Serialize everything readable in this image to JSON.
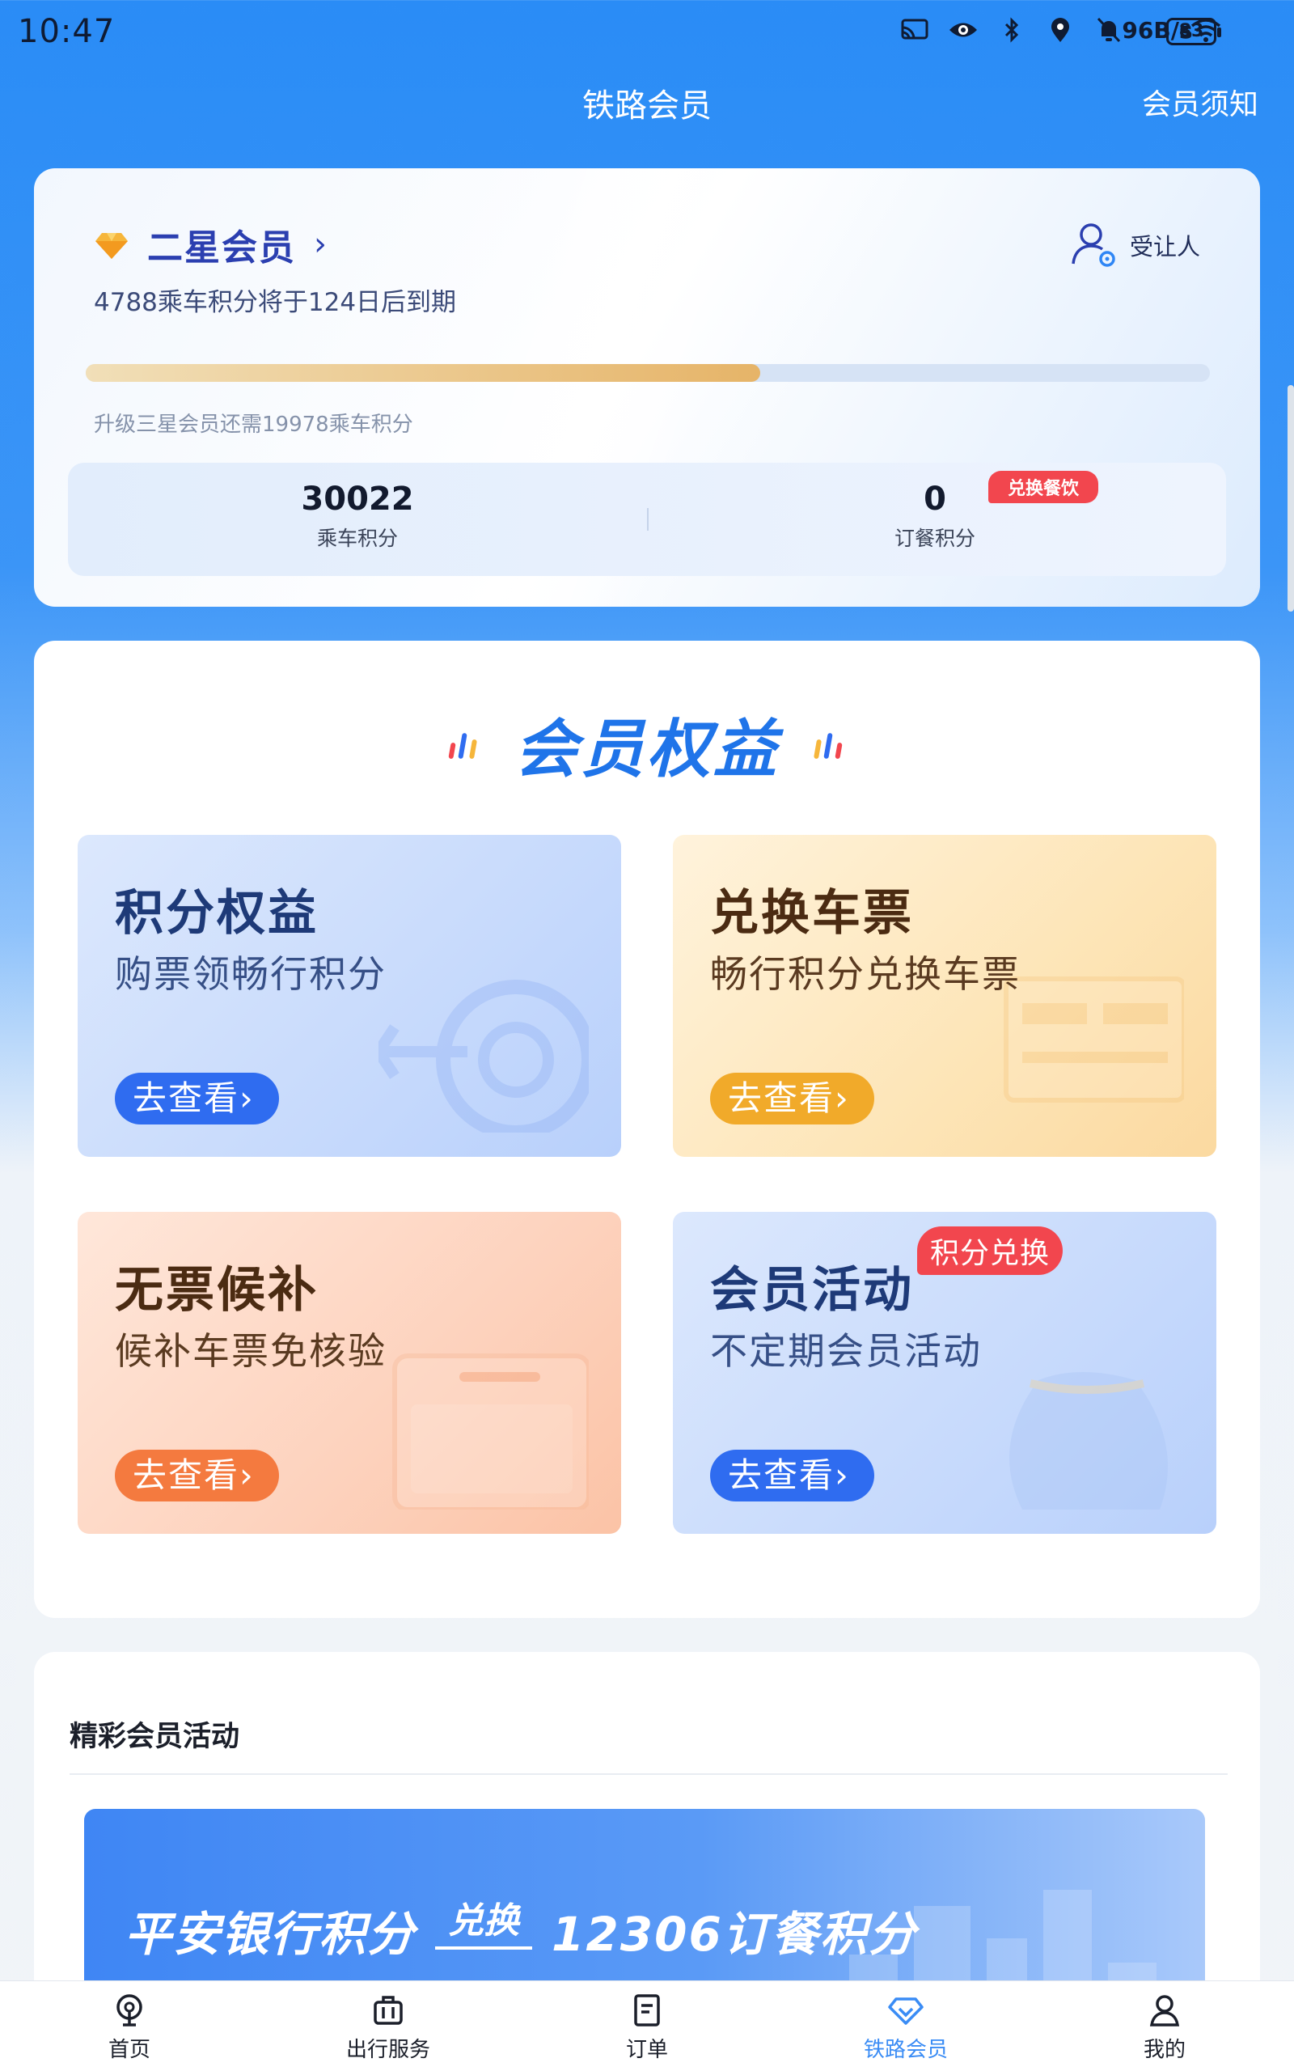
{
  "status_bar": {
    "time": "10:47",
    "net_speed_top": "96",
    "net_speed_bottom": "B/s",
    "battery": "83"
  },
  "header": {
    "title": "铁路会员",
    "notice": "会员须知"
  },
  "member": {
    "level": "二星会员",
    "expire_text": "4788乘车积分将于124日后到期",
    "beneficiary": "受让人",
    "progress": 0.6,
    "upgrade_text": "升级三星会员还需19978乘车积分",
    "ride_points": {
      "value": "30022",
      "label": "乘车积分"
    },
    "meal_points": {
      "value": "0",
      "label": "订餐积分",
      "badge": "兑换餐饮"
    }
  },
  "benefits": {
    "title": "会员权益",
    "tiles": [
      {
        "title": "积分权益",
        "subtitle": "购票领畅行积分",
        "button": "去查看›"
      },
      {
        "title": "兑换车票",
        "subtitle": "畅行积分兑换车票",
        "button": "去查看›"
      },
      {
        "title": "无票候补",
        "subtitle": "候补车票免核验",
        "button": "去查看›"
      },
      {
        "title": "会员活动",
        "subtitle": "不定期会员活动",
        "button": "去查看›",
        "badge": "积分兑换"
      }
    ]
  },
  "activities": {
    "title": "精彩会员活动",
    "banner": {
      "left": "平安银行积分",
      "mid": "兑换",
      "right": "12306订餐积分"
    }
  },
  "bottom_nav": [
    {
      "label": "首页",
      "icon": "home-icon"
    },
    {
      "label": "出行服务",
      "icon": "luggage-icon"
    },
    {
      "label": "订单",
      "icon": "order-icon"
    },
    {
      "label": "铁路会员",
      "icon": "diamond-icon"
    },
    {
      "label": "我的",
      "icon": "user-icon"
    }
  ],
  "colors": {
    "primary": "#2a8cf6",
    "accent_red": "#f2464e",
    "active_nav": "#3a8cf5"
  }
}
